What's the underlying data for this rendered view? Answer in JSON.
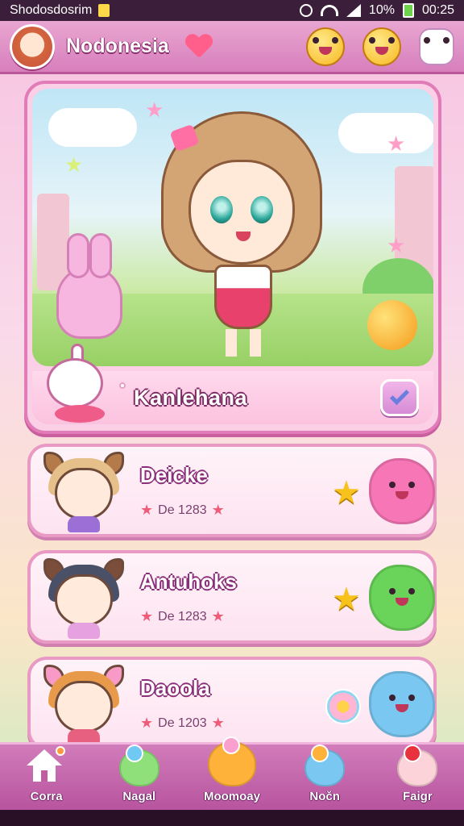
{
  "status_bar": {
    "carrier": "Shodosdosrim",
    "battery_percent": "10%",
    "time": "00:25",
    "icons": [
      "sim-icon",
      "alarm-icon",
      "wifi-icon",
      "signal-icon",
      "battery-icon"
    ]
  },
  "header": {
    "app_title": "Nodonesia",
    "icons": [
      "avatar-icon",
      "heart-icon",
      "yellow-blob-icon",
      "yellow-chick-icon",
      "ghost-icon"
    ]
  },
  "featured": {
    "name": "Kanlehana",
    "selected": true,
    "icons": [
      "bunny-icon",
      "orange-ball-icon",
      "mini-pet-icon",
      "check-icon"
    ]
  },
  "cards": [
    {
      "title": "Deicke",
      "meta": "De 1283",
      "pet_color": "#f776b6",
      "hair": "#e6c08a",
      "ear": "#b47a4a",
      "body": "#9b6fd6",
      "accessory": "star",
      "accessory_icon": "star-icon",
      "pet_icon": "pink-blob-icon"
    },
    {
      "title": "Antuhoks",
      "meta": "De 1283",
      "pet_color": "#6ad45a",
      "hair": "#4a5068",
      "ear": "#7a4e3a",
      "body": "#e6a1e0",
      "accessory": "star",
      "accessory_icon": "star-icon",
      "pet_icon": "green-blob-icon"
    },
    {
      "title": "Daoola",
      "meta": "De 1203",
      "pet_color": "#7ac8f2",
      "hair": "#e79a4a",
      "ear": "#f79ac8",
      "body": "#e8607f",
      "accessory": "flower",
      "accessory_icon": "flower-icon",
      "pet_icon": "blue-blob-icon"
    }
  ],
  "bottom_nav": [
    {
      "label": "Corra",
      "icon": "home-icon",
      "color": "#ffffff",
      "badge": "#ff9a3c"
    },
    {
      "label": "Nagal",
      "icon": "green-critter-icon",
      "color": "#8fe07a",
      "badge": "#6fc9f3"
    },
    {
      "label": "Moomoay",
      "icon": "orange-critter-icon",
      "color": "#ffb23a",
      "badge": "#f9a0cf"
    },
    {
      "label": "Nočn",
      "icon": "blue-critter-icon",
      "color": "#7ac8f2",
      "badge": "#ffb23a"
    },
    {
      "label": "Faigr",
      "icon": "pink-critter-icon",
      "color": "#fbd3d8",
      "badge": "#e8333e"
    }
  ],
  "colors": {
    "accent": "#d77fbc",
    "card_border": "#e89ac5",
    "title_outline": "#8a2e7a"
  }
}
